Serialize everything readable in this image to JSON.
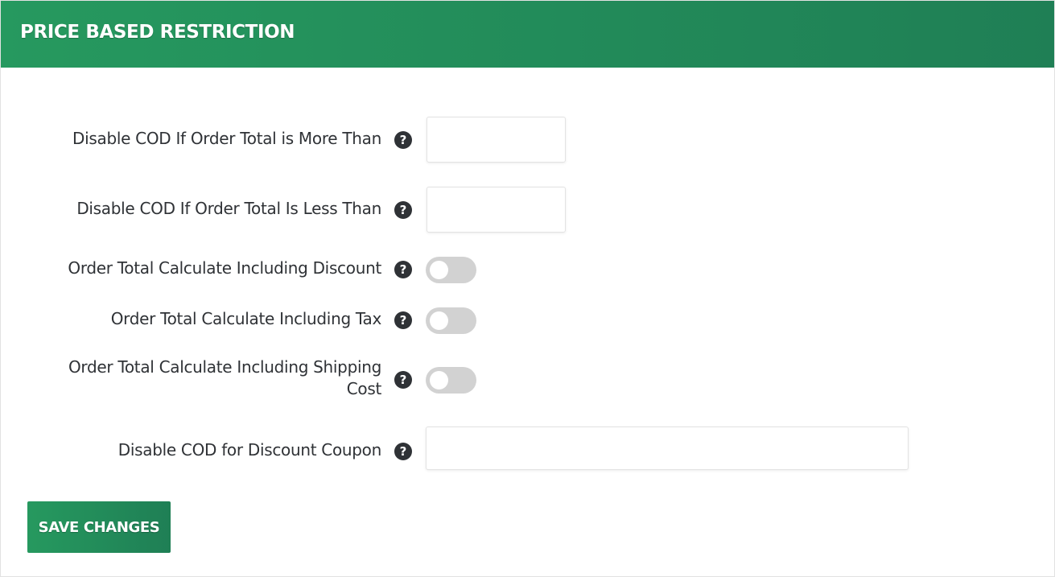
{
  "header": {
    "title": "PRICE BASED RESTRICTION"
  },
  "fields": {
    "more_than": {
      "label": "Disable COD If Order Total is More Than",
      "value": "",
      "help_icon": "question-circle-icon"
    },
    "less_than": {
      "label": "Disable COD If Order Total Is Less Than",
      "value": "",
      "help_icon": "question-circle-icon"
    },
    "including_discount": {
      "label": "Order Total Calculate Including Discount",
      "enabled": false,
      "help_icon": "question-circle-icon"
    },
    "including_tax": {
      "label": "Order Total Calculate Including Tax",
      "enabled": false,
      "help_icon": "question-circle-icon"
    },
    "including_shipping": {
      "label_line1": "Order Total Calculate Including Shipping",
      "label_line2": "Cost",
      "enabled": false,
      "help_icon": "question-circle-icon"
    },
    "discount_coupon": {
      "label": "Disable COD for Discount Coupon",
      "value": "",
      "help_icon": "question-circle-icon"
    }
  },
  "actions": {
    "save_label": "SAVE CHANGES"
  },
  "help_glyph": "?",
  "colors": {
    "header_start": "#26995f",
    "header_end": "#1f7f55",
    "label_text": "#2f3236",
    "toggle_off": "#d2d2d2"
  }
}
